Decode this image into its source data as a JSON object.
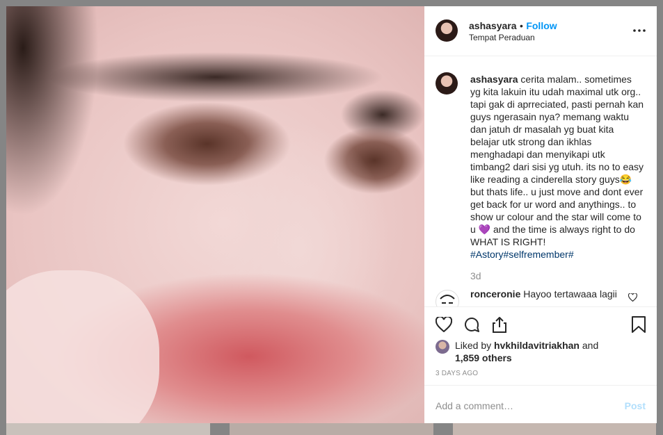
{
  "header": {
    "username": "ashasyara",
    "separator": "•",
    "follow": "Follow",
    "location": "Tempat Peraduan",
    "more_icon": "more-dots-icon"
  },
  "caption": {
    "username": "ashasyara",
    "text": "cerita malam.. sometimes yg kita lakuin itu udah maximal utk org.. tapi gak di aprreciated, pasti pernah kan guys ngerasain nya? memang waktu dan jatuh dr masalah yg buat kita belajar utk strong dan ikhlas menghadapi dan menyikapi utk timbang2 dari sisi yg utuh. its no to easy like reading a cinderella story guys",
    "emoji1": "😂",
    "text2": " but thats life.. u just move and dont ever get back for ur word and anythings.. to show ur colour and the star will come to u ",
    "emoji2": "💜",
    "text3": " and the time is always right to do WHAT IS RIGHT!",
    "hashtags": "#Astory#selfremember#",
    "time": "3d"
  },
  "reply": {
    "username": "ronceronie",
    "text": "Hayoo tertawaaa lagii"
  },
  "actions": {
    "like_icon": "heart-icon",
    "comment_icon": "comment-icon",
    "share_icon": "share-icon",
    "save_icon": "bookmark-icon"
  },
  "likes": {
    "prefix": "Liked by",
    "user": "hvkhildavitriakhan",
    "and": "and",
    "others": "1,859 others"
  },
  "posted": "3 DAYS AGO",
  "comment_box": {
    "placeholder": "Add a comment…",
    "post": "Post"
  },
  "colors": {
    "accent": "#0095f6",
    "post_disabled": "#b2dffc",
    "overlay": "#858585"
  }
}
